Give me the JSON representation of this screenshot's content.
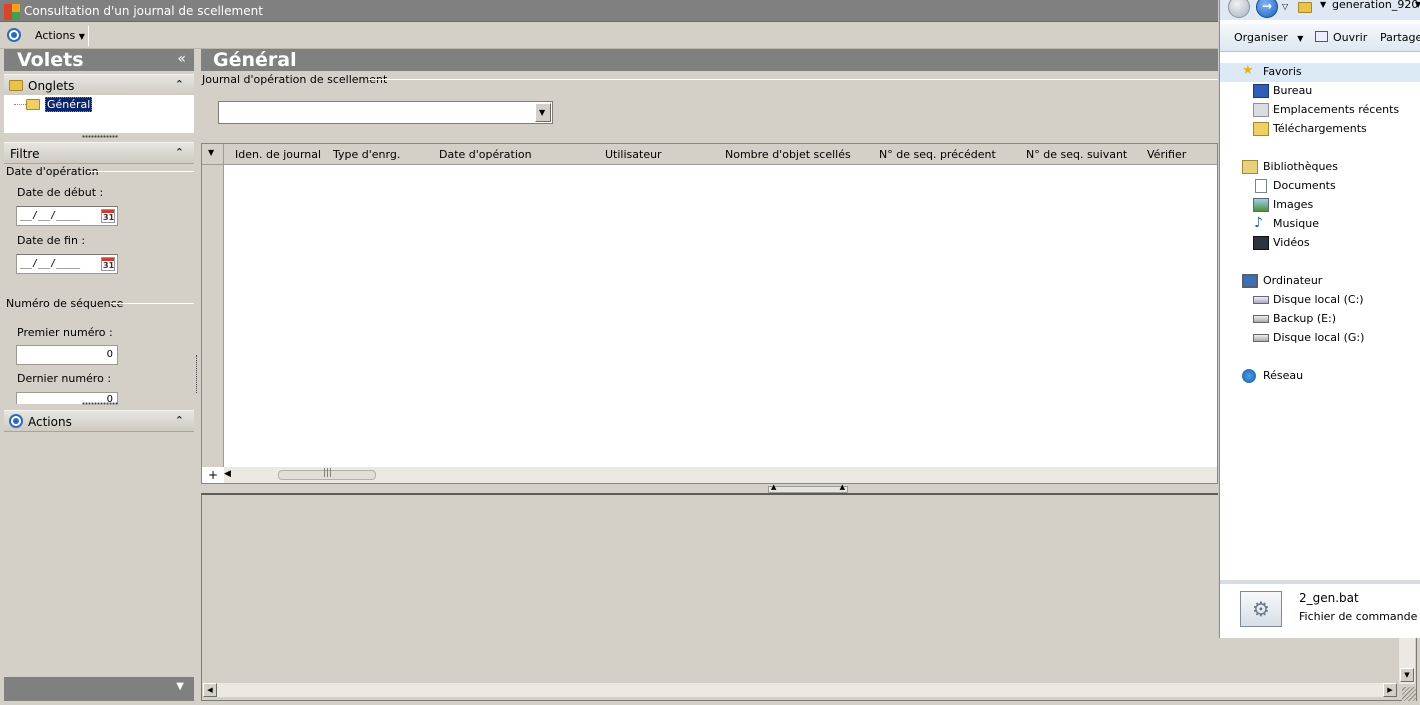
{
  "window": {
    "title": "Consultation d'un journal de scellement",
    "toolbar_actions": "Actions"
  },
  "left_panel": {
    "title": "Volets",
    "collapse_glyph": "«",
    "onglets": {
      "label": "Onglets",
      "tree_item": "Général"
    },
    "filtre": {
      "label": "Filtre",
      "date_group": "Date d'opération",
      "start_label": "Date de début :",
      "start_value": "__/__/____",
      "end_label": "Date de fin :",
      "end_value": "__/__/____",
      "calendar_number": "31",
      "seq_group": "Numéro de séquence",
      "first_label": "Premier numéro :",
      "first_value": "0",
      "last_label": "Dernier numéro :",
      "last_value": "0"
    },
    "actions": {
      "label": "Actions"
    }
  },
  "main": {
    "title": "Général",
    "journal_label": "Journal d'opération de scellement",
    "journal_value": "",
    "columns": [
      "Iden. de journal",
      "Type d'enrg.",
      "Date d'opération",
      "Utilisateur",
      "Nombre d'objet scellés",
      "N° de seq. précédent",
      "N° de seq. suivant",
      "Vérifier"
    ],
    "rows": []
  },
  "explorer": {
    "path": "generation_920",
    "toolbar": {
      "organize": "Organiser",
      "open": "Ouvrir",
      "share": "Partager"
    },
    "favorites": {
      "label": "Favoris",
      "items": [
        "Bureau",
        "Emplacements récents",
        "Téléchargements"
      ]
    },
    "libraries": {
      "label": "Bibliothèques",
      "items": [
        "Documents",
        "Images",
        "Musique",
        "Vidéos"
      ]
    },
    "computer": {
      "label": "Ordinateur",
      "items": [
        "Disque local (C:)",
        "Backup (E:)",
        "Disque local (G:)"
      ]
    },
    "network": {
      "label": "Réseau"
    },
    "selected_file": {
      "name": "2_gen.bat",
      "type": "Fichier de commande Windows"
    }
  }
}
